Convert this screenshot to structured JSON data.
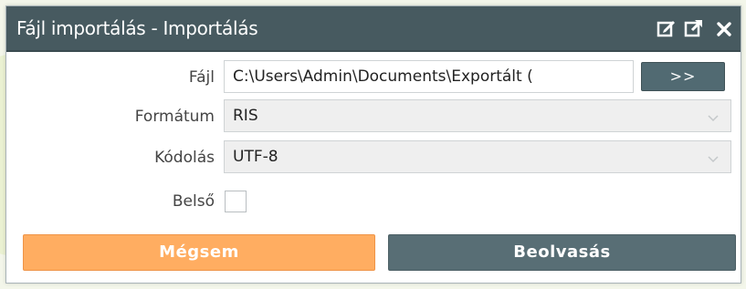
{
  "dialog": {
    "title": "Fájl importálás - Importálás",
    "title_icons": [
      "edit-icon",
      "popout-icon",
      "close-icon"
    ]
  },
  "form": {
    "file": {
      "label": "Fájl",
      "value": "C:\\Users\\Admin\\Documents\\Exportált (",
      "browse_label": ">>"
    },
    "format": {
      "label": "Formátum",
      "value": "RIS"
    },
    "encoding": {
      "label": "Kódolás",
      "value": "UTF-8"
    },
    "internal": {
      "label": "Belső",
      "checked": false
    }
  },
  "buttons": {
    "cancel_label": "Mégsem",
    "read_label": "Beolvasás"
  },
  "colors": {
    "titlebar": "#475a60",
    "cancel": "#ffad61",
    "primary": "#586e75"
  }
}
